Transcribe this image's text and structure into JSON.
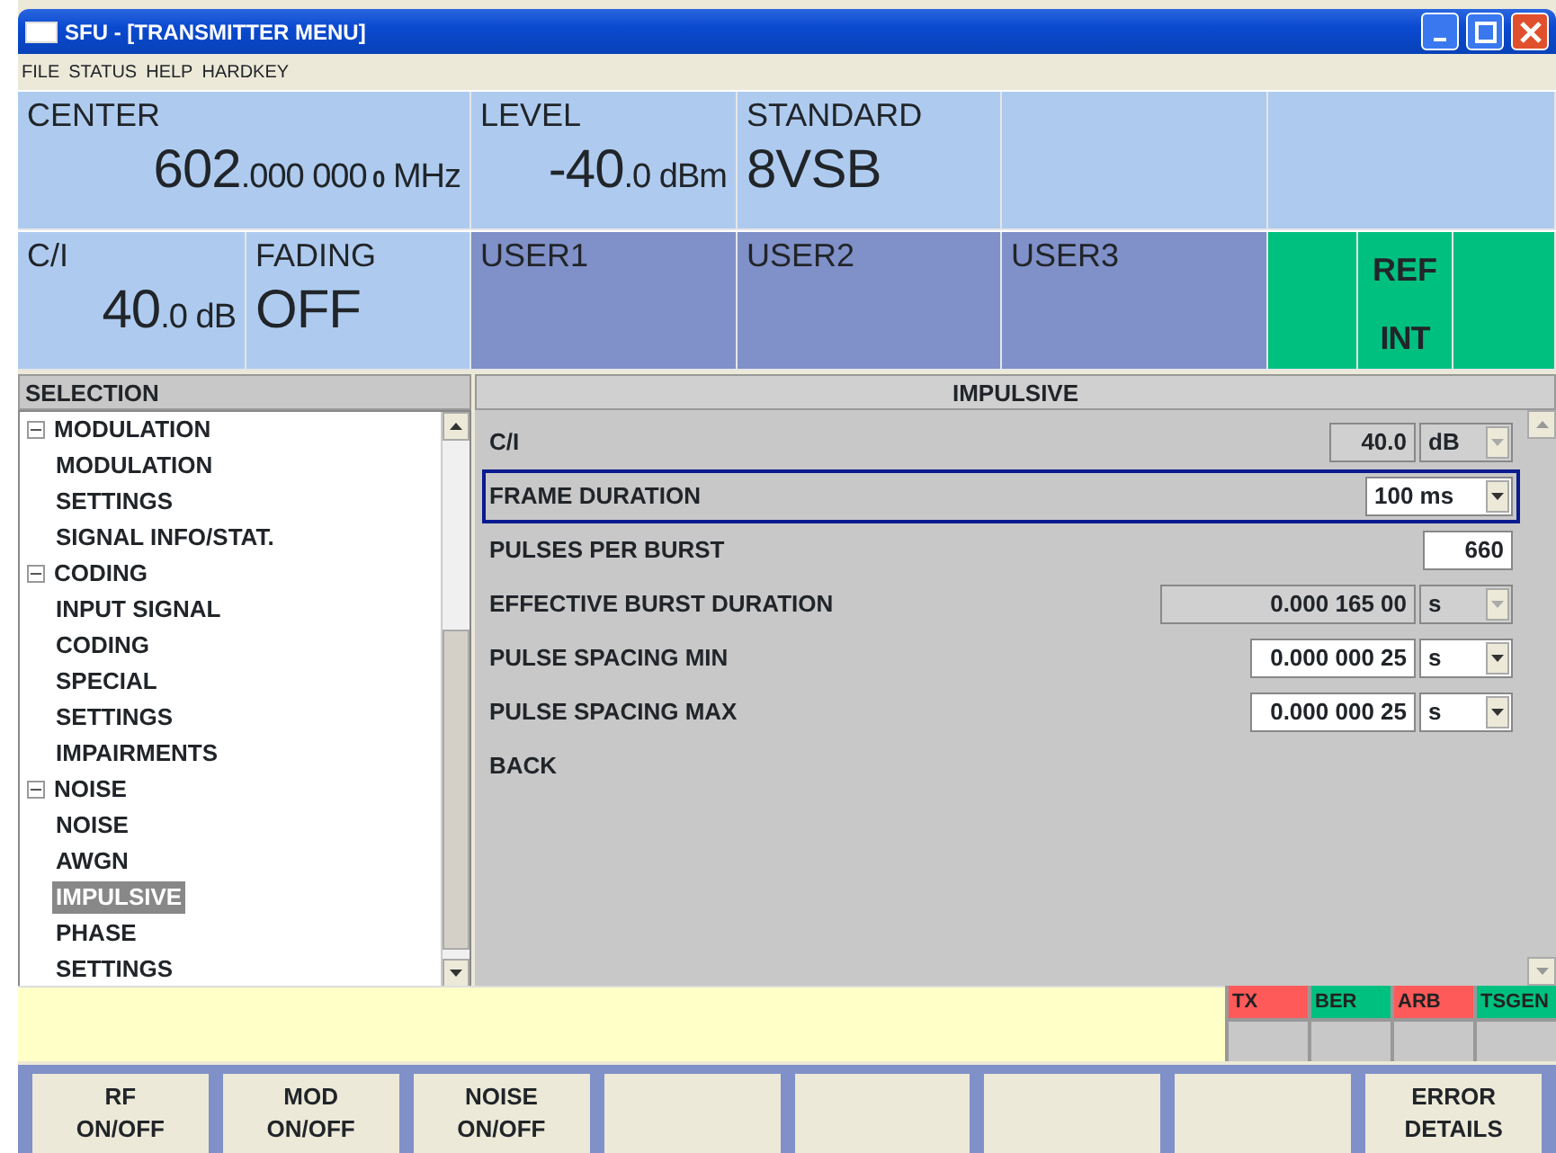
{
  "window": {
    "title": "SFU - [TRANSMITTER MENU]"
  },
  "menu": [
    "FILE",
    "STATUS",
    "HELP",
    "HARDKEY"
  ],
  "header_row_1": [
    {
      "kind": "value",
      "label": "CENTER",
      "value_main": "602",
      "value_fine": ".000 000",
      "value_finest": "0",
      "unit": "MHz"
    },
    {
      "kind": "value",
      "label": "LEVEL",
      "value_main": "-40",
      "value_fine": ".0",
      "unit": "dBm"
    },
    {
      "kind": "text",
      "label": "STANDARD",
      "value_main": "8VSB"
    },
    {
      "kind": "blank"
    },
    {
      "kind": "blank"
    }
  ],
  "header_row_2": [
    {
      "kind": "value",
      "label": "C/I",
      "value_main": "40",
      "value_fine": ".0",
      "unit": "dB"
    },
    {
      "kind": "text",
      "label": "FADING",
      "value_main": "OFF"
    },
    {
      "kind": "user",
      "label": "USER1"
    },
    {
      "kind": "user",
      "label": "USER2"
    },
    {
      "kind": "user",
      "label": "USER3"
    },
    {
      "kind": "green"
    },
    {
      "kind": "green",
      "label": "REF",
      "value_main": "INT"
    },
    {
      "kind": "green"
    }
  ],
  "selection": {
    "title": "SELECTION",
    "tree": [
      {
        "label": "MODULATION",
        "expanded": true,
        "selected": false,
        "children": [
          {
            "label": "MODULATION",
            "selected": false
          },
          {
            "label": "SETTINGS",
            "selected": false
          },
          {
            "label": "SIGNAL INFO/STAT.",
            "selected": false
          }
        ]
      },
      {
        "label": "CODING",
        "expanded": true,
        "selected": false,
        "children": [
          {
            "label": "INPUT SIGNAL",
            "selected": false
          },
          {
            "label": "CODING",
            "selected": false
          },
          {
            "label": "SPECIAL",
            "selected": false
          },
          {
            "label": "SETTINGS",
            "selected": false
          }
        ]
      },
      {
        "label": "IMPAIRMENTS",
        "selected": false
      },
      {
        "label": "NOISE",
        "expanded": true,
        "selected": false,
        "children": [
          {
            "label": "NOISE",
            "selected": false
          },
          {
            "label": "AWGN",
            "selected": false
          },
          {
            "label": "IMPULSIVE",
            "selected": true
          },
          {
            "label": "PHASE",
            "selected": false
          },
          {
            "label": "SETTINGS",
            "selected": false
          }
        ]
      }
    ]
  },
  "panel": {
    "title": "IMPULSIVE",
    "rows": [
      {
        "kind": "number-unit",
        "label": "C/I",
        "value": "40.0",
        "unit": "dB",
        "disabled": true,
        "focused": false
      },
      {
        "kind": "dropdown",
        "label": "FRAME DURATION",
        "value": "100 ms",
        "focused": true
      },
      {
        "kind": "number",
        "label": "PULSES PER BURST",
        "value": "660",
        "focused": false
      },
      {
        "kind": "number-unit",
        "label": "EFFECTIVE BURST DURATION",
        "value": "0.000 165 00",
        "unit": "s",
        "disabled": true,
        "focused": false
      },
      {
        "kind": "number-unit",
        "label": "PULSE SPACING MIN",
        "value": "0.000 000 25",
        "unit": "s",
        "disabled": false,
        "focused": false
      },
      {
        "kind": "number-unit",
        "label": "PULSE SPACING MAX",
        "value": "0.000 000 25",
        "unit": "s",
        "disabled": false,
        "focused": false
      },
      {
        "kind": "link",
        "label": "BACK",
        "focused": false
      }
    ]
  },
  "status_indicators": [
    {
      "label": "TX",
      "color": "#ff5a5a"
    },
    {
      "label": "BER",
      "color": "#00c080"
    },
    {
      "label": "ARB",
      "color": "#ff5a5a"
    },
    {
      "label": "TSGEN",
      "color": "#00c080"
    }
  ],
  "softkeys": [
    {
      "kind": "label",
      "lines": [
        "RF",
        "ON/OFF"
      ]
    },
    {
      "kind": "label",
      "lines": [
        "MOD",
        "ON/OFF"
      ]
    },
    {
      "kind": "label",
      "lines": [
        "NOISE",
        "ON/OFF"
      ]
    },
    {
      "kind": "empty"
    },
    {
      "kind": "empty"
    },
    {
      "kind": "empty"
    },
    {
      "kind": "empty"
    },
    {
      "kind": "label",
      "lines": [
        "ERROR",
        "DETAILS"
      ]
    }
  ]
}
